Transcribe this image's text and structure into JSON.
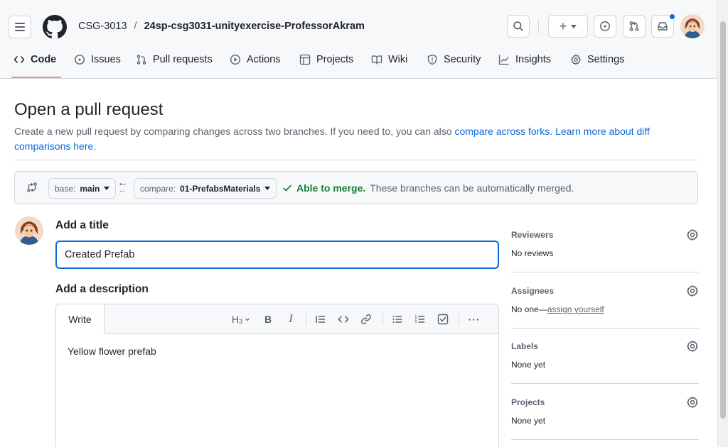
{
  "header": {
    "owner": "CSG-3013",
    "separator": "/",
    "repo": "24sp-csg3031-unityexercise-ProfessorAkram",
    "plus_label": "+",
    "accent_dot_color": "#0969da"
  },
  "tabs": [
    {
      "label": "Code",
      "icon": "code-icon",
      "active": true
    },
    {
      "label": "Issues",
      "icon": "issue-icon"
    },
    {
      "label": "Pull requests",
      "icon": "git-pull-request-icon"
    },
    {
      "label": "Actions",
      "icon": "play-icon"
    },
    {
      "label": "Projects",
      "icon": "table-icon"
    },
    {
      "label": "Wiki",
      "icon": "book-icon"
    },
    {
      "label": "Security",
      "icon": "shield-icon"
    },
    {
      "label": "Insights",
      "icon": "graph-icon"
    },
    {
      "label": "Settings",
      "icon": "gear-icon"
    }
  ],
  "main": {
    "title": "Open a pull request",
    "desc_text": "Create a new pull request by comparing changes across two branches. If you need to, you can also ",
    "desc_link1": "compare across forks.",
    "desc_link2": "Learn more about diff comparisons here."
  },
  "compare": {
    "base_key": "base:",
    "base_value": "main",
    "compare_key": "compare:",
    "compare_value": "01-PrefabsMaterials",
    "status_ok": "Able to merge.",
    "status_rest": "These branches can be automatically merged.",
    "status_color": "#1a7f37"
  },
  "form": {
    "title_label": "Add a title",
    "title_value": "Created Prefab",
    "desc_label": "Add a description",
    "write_tab": "Write",
    "heading_tool": "H",
    "bold_tool": "B",
    "italic_tool": "I",
    "more_tool": "···",
    "desc_value": "Yellow flower prefab"
  },
  "sidebar": {
    "reviewers_label": "Reviewers",
    "reviewers_value": "No reviews",
    "assignees_label": "Assignees",
    "assignees_value": "No one—",
    "assignees_link": "assign yourself",
    "labels_label": "Labels",
    "labels_value": "None yet",
    "projects_label": "Projects",
    "projects_value": "None yet"
  }
}
